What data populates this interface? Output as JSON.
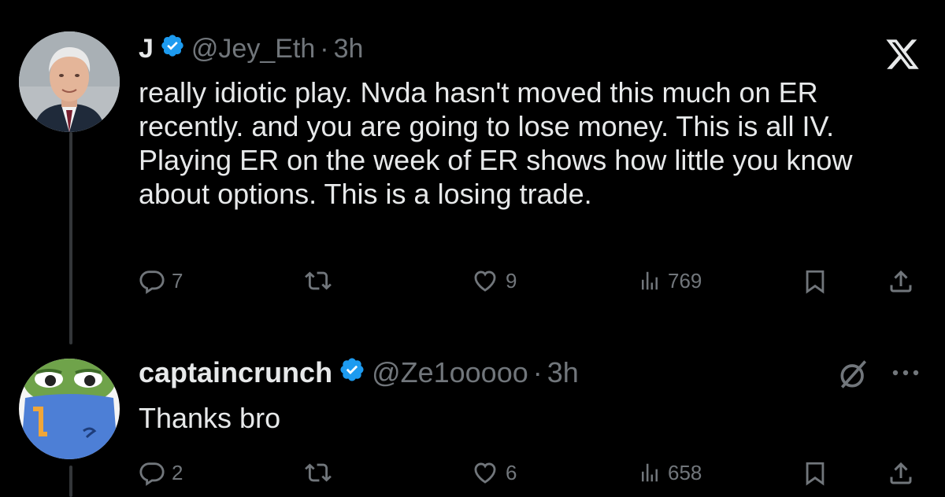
{
  "tweet1": {
    "name": "J",
    "handle": "@Jey_Eth",
    "separator": "·",
    "time": "3h",
    "text": "really idiotic play. Nvda hasn't moved this much on ER recently. and you are going to lose money. This is all IV.  Playing ER on the week of ER shows how little you know about options. This is a losing trade.",
    "actions": {
      "replies": "7",
      "likes": "9",
      "views": "769"
    }
  },
  "tweet2": {
    "name": "captaincrunch",
    "handle": "@Ze1ooooo",
    "separator": "·",
    "time": "3h",
    "text": "Thanks bro",
    "actions": {
      "replies": "2",
      "likes": "6",
      "views": "658"
    }
  },
  "colors": {
    "background": "#000000",
    "text": "#e7e9ea",
    "muted": "#71767b",
    "verified": "#1d9bf0"
  }
}
